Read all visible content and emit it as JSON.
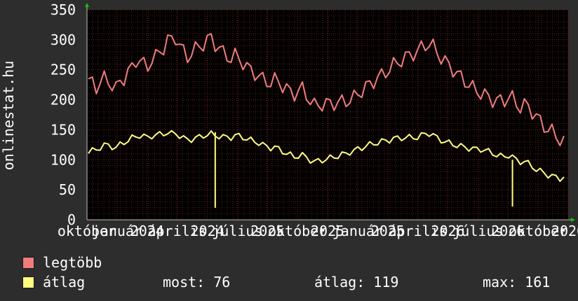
{
  "chart_data": {
    "type": "line",
    "ylabel": "onlinestat.hu",
    "ylim": [
      0,
      350
    ],
    "yticks": [
      0,
      50,
      100,
      150,
      200,
      250,
      300,
      350
    ],
    "x_tick_labels": [
      "október",
      "január",
      "2024",
      "április",
      "2024",
      "július",
      "2025",
      "október",
      "2025",
      "január",
      "2025",
      "április",
      "2026",
      "július",
      "2026",
      "október",
      "2026"
    ],
    "grid": true,
    "series": [
      {
        "name": "legtöbb",
        "color": "#f07d7d",
        "values": [
          235,
          238,
          232,
          240,
          248,
          245,
          236,
          230,
          242,
          245,
          252,
          258,
          268,
          265,
          255,
          249,
          260,
          262,
          268,
          275,
          288,
          286,
          292,
          282,
          270,
          262,
          275,
          282,
          288,
          296,
          305,
          310,
          302,
          298,
          290,
          285,
          282,
          286,
          280,
          272,
          262,
          255,
          248,
          240,
          232,
          226,
          222,
          224,
          220,
          212,
          206,
          200,
          198,
          203,
          208,
          200,
          192,
          186,
          190,
          194,
          197,
          200,
          203,
          205,
          208,
          210,
          213,
          216,
          222,
          226,
          230,
          233,
          236,
          239,
          240,
          243,
          246,
          250,
          253,
          255,
          258,
          262,
          265,
          268,
          276,
          282,
          286,
          283,
          276,
          270,
          266,
          262,
          258,
          253,
          248,
          243,
          238,
          232,
          227,
          223,
          218,
          212,
          206,
          203,
          199,
          197,
          202,
          196,
          184,
          178,
          180,
          176,
          168,
          160,
          152,
          146,
          142,
          140,
          136,
          132,
          130
        ]
      },
      {
        "name": "átlag",
        "color": "#ffff80",
        "values": [
          118,
          120,
          122,
          125,
          128,
          127,
          124,
          121,
          125,
          128,
          130,
          133,
          135,
          136,
          134,
          132,
          135,
          136,
          138,
          140,
          142,
          141,
          143,
          140,
          137,
          135,
          137,
          140,
          142,
          145,
          147,
          148,
          146,
          144,
          142,
          141,
          140,
          142,
          140,
          137,
          133,
          130,
          127,
          124,
          120,
          117,
          115,
          116,
          113,
          110,
          107,
          105,
          103,
          106,
          108,
          105,
          102,
          100,
          102,
          104,
          106,
          108,
          110,
          111,
          113,
          114,
          116,
          117,
          119,
          120,
          122,
          123,
          124,
          125,
          126,
          127,
          128,
          130,
          131,
          132,
          133,
          134,
          135,
          136,
          140,
          144,
          146,
          144,
          140,
          137,
          135,
          133,
          131,
          129,
          127,
          125,
          123,
          121,
          119,
          118,
          116,
          112,
          108,
          105,
          102,
          100,
          103,
          100,
          94,
          92,
          93,
          90,
          86,
          82,
          80,
          78,
          76,
          75,
          74,
          73,
          76
        ],
        "dips": [
          {
            "index": 32,
            "value": 20
          },
          {
            "index": 107,
            "value": 22
          }
        ]
      }
    ]
  },
  "legend": {
    "items": [
      {
        "label": "legtöbb",
        "color": "#f07d7d"
      },
      {
        "label": "átlag",
        "color": "#ffff80"
      }
    ]
  },
  "stats": {
    "most_label": "most:",
    "most_value": "76",
    "atlag_label": "átlag:",
    "atlag_value": "119",
    "max_label": "max:",
    "max_value": "161"
  },
  "colors": {
    "background": "#2d2d2d",
    "plot_background": "#000000",
    "grid": "#5a1a1a",
    "axis": "#c0c0c0",
    "text": "#ffffff",
    "arrow": "#00cc00"
  }
}
